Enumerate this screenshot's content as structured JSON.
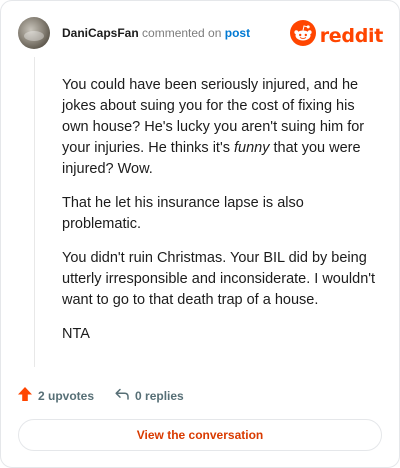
{
  "comment": {
    "username": "DaniCapsFan",
    "action_text": "commented on",
    "post_link": "post",
    "paragraphs": [
      {
        "before": "You could have been seriously injured, and he jokes about suing you for the cost of fixing his own house? He's lucky you aren't suing him for your injuries. He thinks it's ",
        "emphasis": "funny",
        "after": " that you were injured? Wow."
      },
      {
        "text": "That he let his insurance lapse is also problematic."
      },
      {
        "text": "You didn't ruin Christmas. Your BIL did by being utterly irresponsible and inconsiderate. I wouldn't want to go to that death trap of a house."
      },
      {
        "text": "NTA"
      }
    ]
  },
  "brand": {
    "logo_text": "reddit",
    "icon": "reddit-snoo-icon",
    "color": "#ff4500"
  },
  "actions": {
    "upvotes_label": "2 upvotes",
    "upvote_icon": "upvote-arrow-icon",
    "upvote_color": "#ff4500",
    "replies_label": "0 replies",
    "reply_icon": "reply-arrow-icon"
  },
  "cta": {
    "label": "View the conversation",
    "color": "#d93a00"
  }
}
